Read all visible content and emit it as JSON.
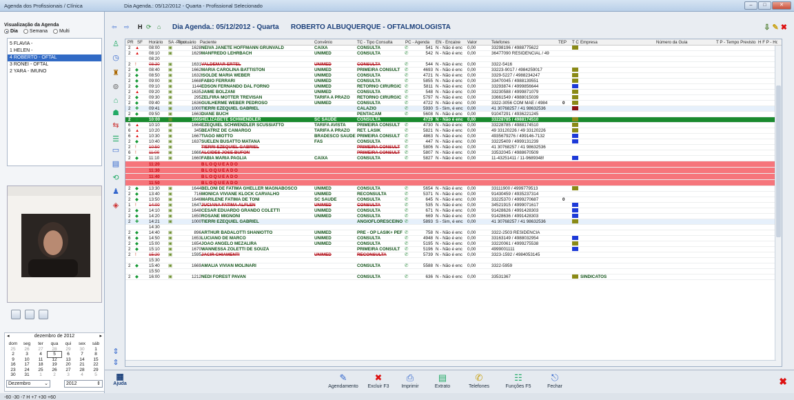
{
  "window": {
    "title_left": "Agenda dos Profissionais / Clínica",
    "title_mid": "Dia Agenda.: 05/12/2012 - Quarta - Profissional Selecionado"
  },
  "left": {
    "visualization_title": "Visualização da Agenda",
    "views": [
      "Dia",
      "Semana",
      "Multi"
    ],
    "professionals": [
      "5 FLAVIA -",
      "1 HELEN -",
      "4 ROBERTO - OFTAL",
      "3 RONEI - OFTAL",
      "2 YARA - IMUNO"
    ],
    "selected_professional_index": 2
  },
  "calendar": {
    "month_label": "dezembro de 2012",
    "weekday_headers": [
      "dom",
      "seg",
      "ter",
      "qua",
      "qui",
      "sex",
      "sáb"
    ],
    "weeks": [
      [
        "25",
        "26",
        "27",
        "28",
        "29",
        "30",
        "1"
      ],
      [
        "2",
        "3",
        "4",
        "5",
        "6",
        "7",
        "8"
      ],
      [
        "9",
        "10",
        "11",
        "12",
        "13",
        "14",
        "15"
      ],
      [
        "16",
        "17",
        "18",
        "19",
        "20",
        "21",
        "22"
      ],
      [
        "23",
        "24",
        "25",
        "26",
        "27",
        "28",
        "29"
      ],
      [
        "30",
        "31",
        "1",
        "2",
        "3",
        "4",
        "5"
      ]
    ],
    "selected_day": "5",
    "month_select": "Dezembro",
    "year_select": "2012",
    "nav_days": "-60  -30  -7   H   +7  +30 +60"
  },
  "header": {
    "day_label": "Dia Agenda.: 05/12/2012 - Quarta",
    "professional_label": "ROBERTO ALBUQUERQUE - OFTALMOLOGISTA",
    "h_label": "H"
  },
  "columns": [
    "PR",
    "SF",
    "Horário",
    "SA - Tipo",
    "Prontuário",
    "Paciente",
    "Convênio",
    "TC - Tipo Consulta",
    "PC - Agenda",
    "EN - Encaixe",
    "Valor",
    "Telefones",
    "TEP",
    "T C",
    "Empresa",
    "Número da Guia",
    "T P - Tempo Previsto",
    "H F P - Horário Previsto"
  ],
  "rows": [
    {
      "pr": "2",
      "sf": "▲",
      "hora": "08:00",
      "pront": "1628",
      "pac": "NEIVA JANETE HOFFMANN GRUNVALD",
      "conv": "CAIXA",
      "tc": "CONSULTA",
      "pc": "541",
      "en": "N - Não é enc",
      "val": "0,00",
      "tel": "33298196 / 4988775622",
      "tcc": "#8a8a16",
      "strike": false,
      "kind": "normal"
    },
    {
      "pr": "2",
      "sf": "▲",
      "hora": "08:10",
      "pront": "1629",
      "pac": "MANFREDO LEHRBACH",
      "conv": "UNIMED",
      "tc": "CONSULTA",
      "pc": "542",
      "en": "N - Não é enc",
      "val": "0,00",
      "tel": "36477090 RESIDENCIAL / 49",
      "tcc": "",
      "strike": false,
      "kind": "normal"
    },
    {
      "pr": "",
      "sf": "",
      "hora": "08:20",
      "pront": "",
      "pac": "",
      "conv": "",
      "tc": "",
      "pc": "",
      "en": "",
      "val": "",
      "tel": "",
      "tcc": "",
      "strike": false,
      "kind": "empty"
    },
    {
      "pr": "2",
      "sf": "!",
      "hora": "08:30",
      "pront": "1631",
      "pac": "VALDEMAR ERTEL",
      "conv": "UNIMED",
      "tc": "CONSULTA",
      "pc": "544",
      "en": "N - Não é enc",
      "val": "0,00",
      "tel": "3322-5416",
      "tcc": "",
      "strike": true,
      "kind": "normal"
    },
    {
      "pr": "2",
      "sf": "◆",
      "hora": "08:40",
      "pront": "1662",
      "pac": "MARIA CAROLINA BATTISTON",
      "conv": "UNIMED",
      "tc": "PRIMEIRA CONSULT",
      "pc": "4693",
      "en": "N - Não é enc",
      "val": "0,00",
      "tel": "33223-9017 / 4984259017",
      "tcc": "#8a8a16",
      "strike": false,
      "kind": "normal"
    },
    {
      "pr": "2",
      "sf": "◆",
      "hora": "08:50",
      "pront": "1632",
      "pac": "ISOLDE MARIA WEBER",
      "conv": "UNIMED",
      "tc": "CONSULTA",
      "pc": "4721",
      "en": "N - Não é enc",
      "val": "0,00",
      "tel": "3329-5227 / 4988234247",
      "tcc": "#8a8a16",
      "strike": false,
      "kind": "normal"
    },
    {
      "pr": "2",
      "sf": "◆",
      "hora": "09:00",
      "pront": "1668",
      "pac": "FABIO FERRARI",
      "conv": "UNIMED",
      "tc": "CONSULTA",
      "pc": "5855",
      "en": "N - Não é enc",
      "val": "0,00",
      "tel": "33470045 / 4988139551",
      "tcc": "#8a8a16",
      "strike": false,
      "kind": "normal"
    },
    {
      "pr": "2",
      "sf": "◆",
      "hora": "09:10",
      "pront": "1144",
      "pac": "EDSON FERNANDO DAL FORNO",
      "conv": "UNIMED",
      "tc": "RETORNO CIRURGIC",
      "pc": "5811",
      "en": "N - Não é enc",
      "val": "0,00",
      "tel": "33293874 / 4999856644",
      "tcc": "#1d3ad8",
      "strike": false,
      "kind": "normal"
    },
    {
      "pr": "2",
      "sf": "▲",
      "hora": "09:20",
      "pront": "1635",
      "pac": "JAIME BOLZANI",
      "conv": "UNIMED",
      "tc": "CONSULTA",
      "pc": "548",
      "en": "N - Não é enc",
      "val": "0,00",
      "tel": "33230588 / 4999871079",
      "tcc": "#8a8a16",
      "strike": false,
      "kind": "normal"
    },
    {
      "pr": "2",
      "sf": "◆",
      "hora": "09:30",
      "pront": "295",
      "pac": "ZELFIRA MOTTER TREVISAN",
      "conv": "TARIFA A PRAZO",
      "tc": "RETORNO CIRURGIC",
      "pc": "5797",
      "en": "N - Não é enc",
      "val": "0,00",
      "tel": "33661549 / 4988015039",
      "tcc": "#8a8a16",
      "strike": false,
      "kind": "normal"
    },
    {
      "pr": "2",
      "sf": "◆",
      "hora": "09:40",
      "pront": "1636",
      "pac": "GUILHERME WEBER PEDROSO",
      "conv": "UNIMED",
      "tc": "CONSULTA",
      "pc": "4722",
      "en": "N - Não é enc",
      "val": "0,00",
      "tel": "3322-3056 COM MÃE / 4984",
      "tcc": "#8a8a16",
      "strike": false,
      "kind": "black"
    },
    {
      "pr": "2",
      "sf": "✚",
      "hora": "09:41",
      "pront": "1000",
      "pac": "TIERRI EZEQUIEL GABRIEL",
      "conv": "",
      "tc": "CALAZIO",
      "pc": "5930",
      "en": "S - Sim, é enc",
      "val": "0,00",
      "tel": "41 30768257 / 41 98632536",
      "tcc": "#8b1414",
      "strike": false,
      "kind": "light"
    },
    {
      "pr": "2",
      "sf": "◆",
      "hora": "09:50",
      "pront": "1663",
      "pac": "DIANE BUCH",
      "conv": "",
      "tc": "PENTACAM",
      "pc": "5608",
      "en": "N - Não é enc",
      "val": "0,00",
      "tel": "91047291 / 4936221245",
      "tcc": "",
      "strike": false,
      "kind": "normal"
    },
    {
      "pr": "2",
      "sf": "◆",
      "hora": "10:00",
      "pront": "1665",
      "pac": "HELIZABETE SCHWENDLER",
      "conv": "SC SAUDE",
      "tc": "CONSULTA",
      "pc": "4729",
      "en": "N - Não é enc",
      "val": "0,00",
      "tel": "33228785 / 4988174510",
      "tcc": "#8a8a16",
      "strike": false,
      "kind": "cur"
    },
    {
      "pr": "6",
      "sf": "▲",
      "hora": "10:10",
      "pront": "1664",
      "pac": "EZEQUIEL SCHWENDLER SCUSSIATTO",
      "conv": "TARIFA AVISTA",
      "tc": "PRIMEIRA CONSULT",
      "pc": "4730",
      "en": "N - Não é enc",
      "val": "0,00",
      "tel": "33228785 / 4988174510",
      "tcc": "#8a8a16",
      "strike": false,
      "kind": "normal"
    },
    {
      "pr": "6",
      "sf": "▲",
      "hora": "10:20",
      "pront": "345",
      "pac": "BEATRIZ DE CAMARGO",
      "conv": "TARIFA A PRAZO",
      "tc": "RET. LASIK",
      "pc": "5821",
      "en": "N - Não é enc",
      "val": "0,00",
      "tel": "49 33120226 / 49 33120226",
      "tcc": "#8a8a16",
      "strike": false,
      "kind": "normal"
    },
    {
      "pr": "6",
      "sf": "▲",
      "hora": "10:30",
      "pront": "1667",
      "pac": "TIAGO MIOTTO",
      "conv": "BRADESCO SAUDE",
      "tc": "PRIMEIRA CONSULT",
      "pc": "4863",
      "en": "N - Não é enc",
      "val": "0,00",
      "tel": "4935679276 / 499146-7132",
      "tcc": "#1d3ad8",
      "strike": false,
      "kind": "normal"
    },
    {
      "pr": "2",
      "sf": "◆",
      "hora": "10:40",
      "pront": "1637",
      "pac": "SUELEN BUSATTO MATANA",
      "conv": "FAS",
      "tc": "CONSULTA",
      "pc": "447",
      "en": "N - Não é enc",
      "val": "0,00",
      "tel": "33225409 / 4999131239",
      "tcc": "#1d3ad8",
      "strike": false,
      "kind": "normal"
    },
    {
      "pr": "2",
      "sf": "!",
      "hora": "10:50",
      "pront": "",
      "pac": "TIERRI EZEQUIEL GABRIEL",
      "conv": "",
      "tc": "PRIMEIRA CONSULT",
      "pc": "5806",
      "en": "N - Não é enc",
      "val": "0,00",
      "tel": "41 30768257 / 41 98632536",
      "tcc": "",
      "strike": true,
      "kind": "normal"
    },
    {
      "pr": "6",
      "sf": "!",
      "hora": "11:00",
      "pront": "1666",
      "pac": "ALCIDES JOSE BUFON",
      "conv": "",
      "tc": "PRIMEIRA CONSULT",
      "pc": "5807",
      "en": "N - Não é enc",
      "val": "0,00",
      "tel": "33532045 / 4988670509",
      "tcc": "",
      "strike": true,
      "kind": "normal"
    },
    {
      "pr": "2",
      "sf": "◆",
      "hora": "11:10",
      "pront": "1660",
      "pac": "FABIA MARIA PAGLIA",
      "conv": "CAIXA",
      "tc": "CONSULTA",
      "pc": "5827",
      "en": "N - Não é enc",
      "val": "0,00",
      "tel": "11-43251411 / 11-9689348!",
      "tcc": "#1d3ad8",
      "strike": false,
      "kind": "normal"
    },
    {
      "pr": "",
      "sf": "",
      "hora": "11:20",
      "pront": "",
      "pac": "BLOQUEADO",
      "conv": "",
      "tc": "",
      "pc": "",
      "en": "",
      "val": "",
      "tel": "",
      "tcc": "",
      "strike": false,
      "kind": "blk"
    },
    {
      "pr": "",
      "sf": "",
      "hora": "11:30",
      "pront": "",
      "pac": "BLOQUEADO",
      "conv": "",
      "tc": "",
      "pc": "",
      "en": "",
      "val": "",
      "tel": "",
      "tcc": "",
      "strike": false,
      "kind": "blk"
    },
    {
      "pr": "",
      "sf": "",
      "hora": "11:40",
      "pront": "",
      "pac": "BLOQUEADO",
      "conv": "",
      "tc": "",
      "pc": "",
      "en": "",
      "val": "",
      "tel": "",
      "tcc": "",
      "strike": false,
      "kind": "blk"
    },
    {
      "pr": "",
      "sf": "",
      "hora": "11:50",
      "pront": "",
      "pac": "BLOQUEADO",
      "conv": "",
      "tc": "",
      "pc": "",
      "en": "",
      "val": "",
      "tel": "",
      "tcc": "",
      "strike": false,
      "kind": "blk"
    },
    {
      "pr": "2",
      "sf": "◆",
      "hora": "13:30",
      "pront": "1644",
      "pac": "BELONI DE FATIMA GHELLER MAGNABOSCO",
      "conv": "UNIMED",
      "tc": "CONSULTA",
      "pc": "5654",
      "en": "N - Não é enc",
      "val": "0,00",
      "tel": "33111900 / 4999779513",
      "tcc": "#8a8a16",
      "strike": false,
      "kind": "normal"
    },
    {
      "pr": "2",
      "sf": "◆",
      "hora": "13:40",
      "pront": "716",
      "pac": "MONICA VIVIANE KLOCK CARVALHO",
      "conv": "UNIMED",
      "tc": "RECONSULTA",
      "pc": "5371",
      "en": "N - Não é enc",
      "val": "0,00",
      "tel": "91430459 / 4935237314",
      "tcc": "",
      "strike": false,
      "kind": "normal"
    },
    {
      "pr": "2",
      "sf": "◆",
      "hora": "13:50",
      "pront": "1646",
      "pac": "MARILENE FATIMA DE TONI",
      "conv": "SC SAUDE",
      "tc": "CONSULTA",
      "pc": "645",
      "en": "N - Não é enc",
      "val": "0,00",
      "tel": "33225370 / 4999270687",
      "tcc": "",
      "strike": false,
      "kind": "black"
    },
    {
      "pr": "1",
      "sf": "!",
      "hora": "14:00",
      "pront": "1647",
      "pac": "JUCIANA FATIMA ALFLEN",
      "conv": "UNIMED",
      "tc": "CONSULTA",
      "pc": "535",
      "en": "N - Não é enc",
      "val": "0,00",
      "tel": "34521915 / 4999071617",
      "tcc": "#1d3ad8",
      "strike": true,
      "kind": "normal"
    },
    {
      "pr": "2",
      "sf": "◆",
      "hora": "14:10",
      "pront": "1648",
      "pac": "CESAR EDUARDO GRANDO COLETTI",
      "conv": "UNIMED",
      "tc": "CONSULTA",
      "pc": "671",
      "en": "N - Não é enc",
      "val": "0,00",
      "tel": "91428626 / 4991428303",
      "tcc": "#1d3ad8",
      "strike": false,
      "kind": "normal"
    },
    {
      "pr": "2",
      "sf": "◆",
      "hora": "14:20",
      "pront": "1650",
      "pac": "ROSANE MIGNONI",
      "conv": "UNIMED",
      "tc": "CONSULTA",
      "pc": "669",
      "en": "N - Não é enc",
      "val": "0,00",
      "tel": "91428636 / 4991428303",
      "tcc": "#1d3ad8",
      "strike": false,
      "kind": "normal"
    },
    {
      "pr": "2",
      "sf": "✚",
      "hora": "14:21",
      "pront": "1000",
      "pac": "TIERRI EZEQUIEL GABRIEL",
      "conv": "",
      "tc": "ANGIOFLORESCEINO",
      "pc": "5893",
      "en": "S - Sim, é enc",
      "val": "0,00",
      "tel": "41 30768257 / 41 98632536",
      "tcc": "#8a8a16",
      "strike": false,
      "kind": "light"
    },
    {
      "pr": "",
      "sf": "",
      "hora": "14:30",
      "pront": "",
      "pac": "",
      "conv": "",
      "tc": "",
      "pc": "",
      "en": "",
      "val": "",
      "tel": "",
      "tcc": "",
      "strike": false,
      "kind": "empty"
    },
    {
      "pr": "2",
      "sf": "◆",
      "hora": "14:40",
      "pront": "896",
      "pac": "ARTHUR BADALOTTI SHANIOTTO",
      "conv": "UNIMED",
      "tc": "PRE - OP LASIK+ PEF",
      "pc": "758",
      "en": "N - Não é enc",
      "val": "0,00",
      "tel": "3322-2503 RESIDENCIA",
      "tcc": "",
      "strike": false,
      "kind": "normal"
    },
    {
      "pr": "6",
      "sf": "◆",
      "hora": "14:50",
      "pront": "1653",
      "pac": "LUCIANO DE MARCO",
      "conv": "UNIMED",
      "tc": "CONSULTA",
      "pc": "4948",
      "en": "N - Não é enc",
      "val": "0,00",
      "tel": "33163149 / 4988032954",
      "tcc": "#1d3ad8",
      "strike": false,
      "kind": "normal"
    },
    {
      "pr": "2",
      "sf": "◆",
      "hora": "15:00",
      "pront": "1654",
      "pac": "JOAO ANGELO MEZALIRA",
      "conv": "UNIMED",
      "tc": "CONSULTA",
      "pc": "5195",
      "en": "N - Não é enc",
      "val": "0,00",
      "tel": "33220061 / 4999275538",
      "tcc": "#8a8a16",
      "strike": false,
      "kind": "normal"
    },
    {
      "pr": "2",
      "sf": "◆",
      "hora": "15:10",
      "pront": "1670",
      "pac": "WANNESSA ZOLETTI DE SOUZA",
      "conv": "",
      "tc": "PRIMEIRA CONSULT",
      "pc": "5196",
      "en": "N - Não é enc",
      "val": "0,00",
      "tel": "4999001111",
      "tcc": "#1d3ad8",
      "strike": false,
      "kind": "normal"
    },
    {
      "pr": "2",
      "sf": "!",
      "hora": "15:20",
      "pront": "1595",
      "pac": "JACIR CHIAMENTI",
      "conv": "UNIMED",
      "tc": "RECONSULTA",
      "pc": "5739",
      "en": "N - Não é enc",
      "val": "0,00",
      "tel": "3323-1592 / 4984053145",
      "tcc": "",
      "strike": true,
      "kind": "normal"
    },
    {
      "pr": "",
      "sf": "",
      "hora": "15:30",
      "pront": "",
      "pac": "",
      "conv": "",
      "tc": "",
      "pc": "",
      "en": "",
      "val": "",
      "tel": "",
      "tcc": "",
      "strike": false,
      "kind": "empty"
    },
    {
      "pr": "2",
      "sf": "◆",
      "hora": "15:40",
      "pront": "1669",
      "pac": "AMALIA VIVIAN MOLINARI",
      "conv": "",
      "tc": "CONSULTA",
      "pc": "5588",
      "en": "N - Não é enc",
      "val": "0,00",
      "tel": "3322-5959",
      "tcc": "",
      "strike": false,
      "kind": "normal"
    },
    {
      "pr": "",
      "sf": "",
      "hora": "15:50",
      "pront": "",
      "pac": "",
      "conv": "",
      "tc": "",
      "pc": "",
      "en": "",
      "val": "",
      "tel": "",
      "tcc": "",
      "strike": false,
      "kind": "empty"
    },
    {
      "pr": "2",
      "sf": "◆",
      "hora": "16:00",
      "pront": "1212",
      "pac": "NEDI FOREST PAVAN",
      "conv": "",
      "tc": "CONSULTA",
      "pc": "636",
      "en": "N - Não é enc",
      "val": "0,00",
      "tel": "33531367",
      "tcc": "#8a8a16",
      "empresa": "SINDICATOS",
      "strike": false,
      "kind": "normal"
    }
  ],
  "tep_marks": {
    "10": "0",
    "27": "0"
  },
  "bottom": {
    "help": "Ajuda",
    "buttons": [
      "Agendamento",
      "Excluir F3",
      "Imprimir",
      "Extrato",
      "Telefones",
      "Funções F5",
      "Fechar"
    ]
  },
  "colors": {
    "current_row": "#1a8a2e",
    "blocked": "#f6757b",
    "selected_prof": "#316ac5",
    "swatch_olive": "#8a8a16",
    "swatch_blue": "#1d3ad8",
    "swatch_red": "#8b1414"
  }
}
